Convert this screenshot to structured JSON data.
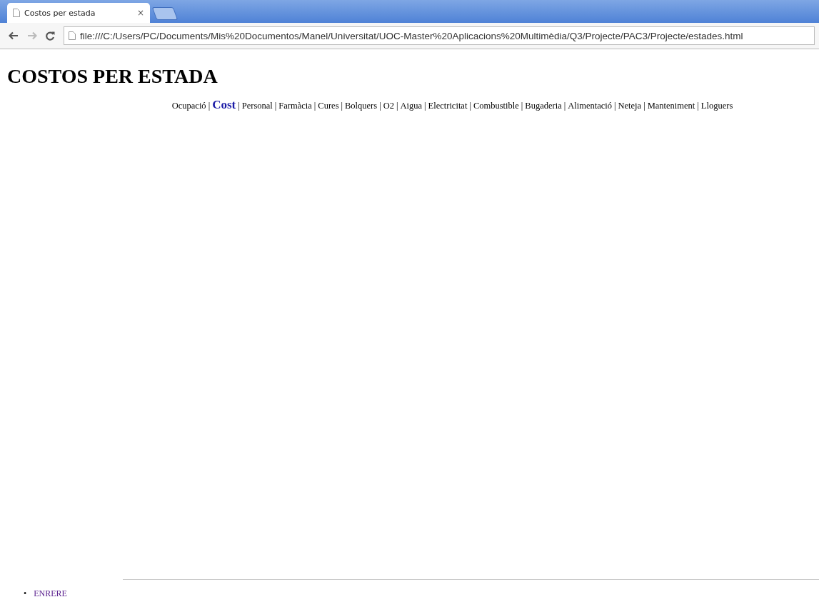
{
  "browser": {
    "tab_title": "Costos per estada",
    "tab_close": "×",
    "address": "file:///C:/Users/PC/Documents/Mis%20Documentos/Manel/Universitat/UOC-Master%20Aplicacions%20Multimèdia/Q3/Projecte/PAC3/Projecte/estades.html"
  },
  "page": {
    "heading": "COSTOS PER ESTADA",
    "nav_separator": "|",
    "nav": [
      {
        "label": "Ocupació",
        "selected": false
      },
      {
        "label": "Cost",
        "selected": true
      },
      {
        "label": "Personal",
        "selected": false
      },
      {
        "label": "Farmàcia",
        "selected": false
      },
      {
        "label": "Cures",
        "selected": false
      },
      {
        "label": "Bolquers",
        "selected": false
      },
      {
        "label": "O2",
        "selected": false
      },
      {
        "label": "Aigua",
        "selected": false
      },
      {
        "label": "Electricitat",
        "selected": false
      },
      {
        "label": "Combustible",
        "selected": false
      },
      {
        "label": "Bugaderia",
        "selected": false
      },
      {
        "label": "Alimentació",
        "selected": false
      },
      {
        "label": "Neteja",
        "selected": false
      },
      {
        "label": "Manteniment",
        "selected": false
      },
      {
        "label": "Lloguers",
        "selected": false
      }
    ],
    "footer_links": [
      {
        "bullet": "•",
        "label": "ENRERE"
      }
    ]
  }
}
